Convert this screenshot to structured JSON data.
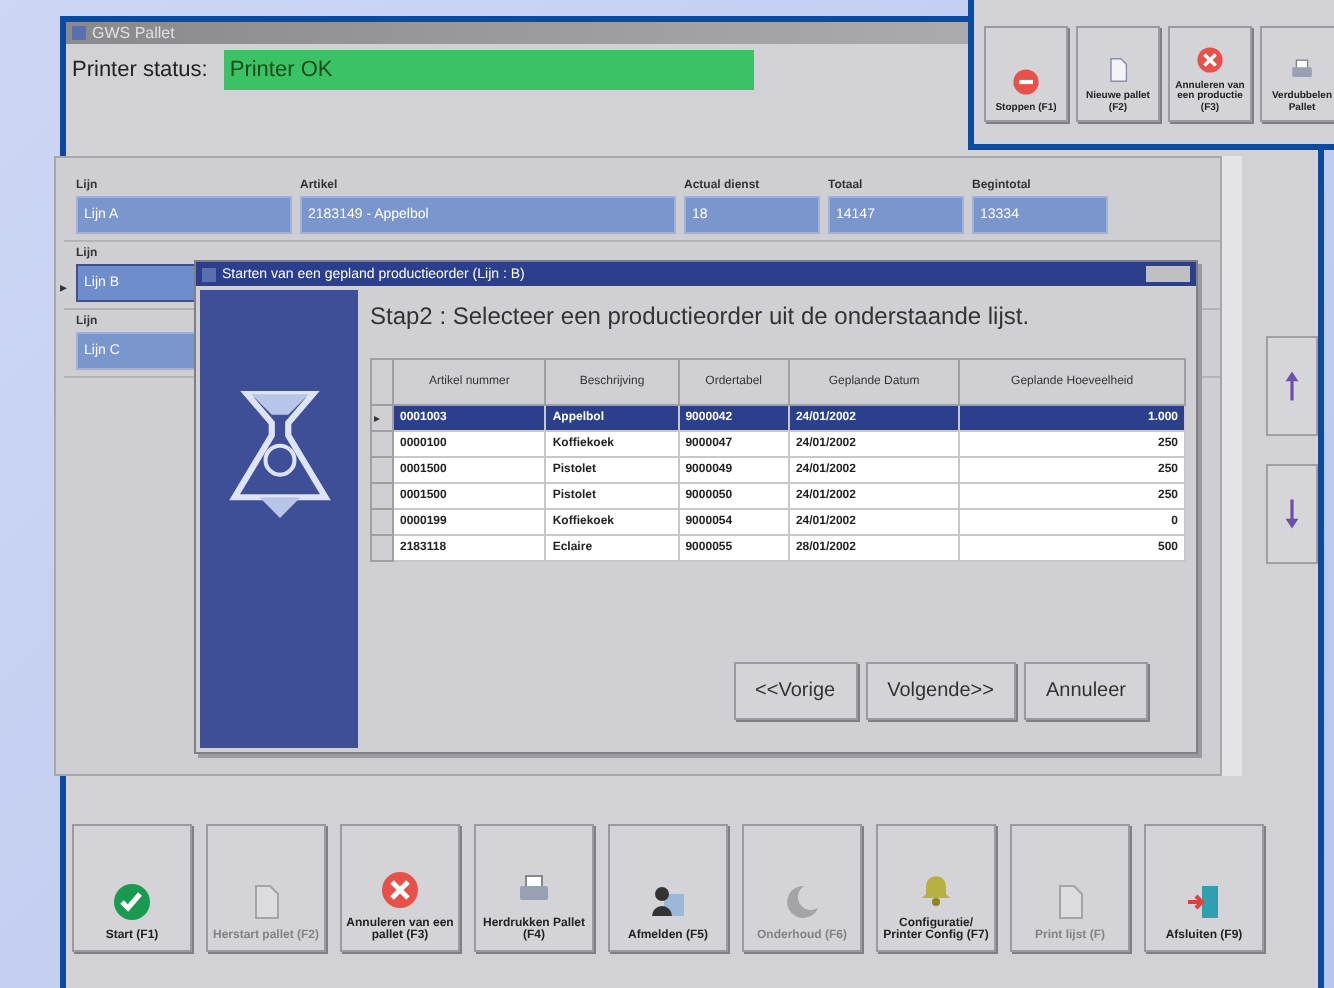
{
  "window": {
    "title": "GWS Pallet"
  },
  "printer_status": {
    "label": "Printer status:",
    "value": "Printer OK",
    "ok": true
  },
  "lines": [
    {
      "selected": false,
      "cells": [
        {
          "header": "Lijn",
          "value": "Lijn A"
        },
        {
          "header": "Artikel",
          "value": "2183149 - Appelbol"
        },
        {
          "header": "Actual dienst",
          "value": "18"
        },
        {
          "header": "Totaal",
          "value": "14147"
        },
        {
          "header": "Begintotal",
          "value": "13334"
        }
      ]
    },
    {
      "selected": true,
      "marker": "▸",
      "cells": [
        {
          "header": "Lijn",
          "value": "Lijn B"
        }
      ]
    },
    {
      "selected": false,
      "cells": [
        {
          "header": "Lijn",
          "value": "Lijn C"
        }
      ]
    }
  ],
  "side_buttons": [
    {
      "kind": "up"
    },
    {
      "kind": "down"
    }
  ],
  "dialog": {
    "title": "Starten van een gepland productieorder (Lijn : B)",
    "heading": "Stap2 : Selecteer een productieorder uit de onderstaande lijst.",
    "columns": [
      "Artikel nummer",
      "Beschrijving",
      "Ordertabel",
      "Geplande Datum",
      "Geplande Hoeveelheid"
    ],
    "rows": [
      {
        "selected": true,
        "marker": "▸",
        "cells": [
          "0001003",
          "Appelbol",
          "9000042",
          "24/01/2002",
          "1.000"
        ]
      },
      {
        "selected": false,
        "cells": [
          "0000100",
          "Koffiekoek",
          "9000047",
          "24/01/2002",
          "250"
        ]
      },
      {
        "selected": false,
        "cells": [
          "0001500",
          "Pistolet",
          "9000049",
          "24/01/2002",
          "250"
        ]
      },
      {
        "selected": false,
        "cells": [
          "0001500",
          "Pistolet",
          "9000050",
          "24/01/2002",
          "250"
        ]
      },
      {
        "selected": false,
        "cells": [
          "0000199",
          "Koffiekoek",
          "9000054",
          "24/01/2002",
          "0"
        ]
      },
      {
        "selected": false,
        "cells": [
          "2183118",
          "Eclaire",
          "9000055",
          "28/01/2002",
          "500"
        ]
      }
    ],
    "buttons": [
      "<<Vorige",
      "Volgende>>",
      "Annuleer"
    ]
  },
  "toolbar": [
    {
      "kind": "check",
      "label": "Start (F1)",
      "disabled": false
    },
    {
      "kind": "page",
      "label": "Herstart pallet (F2)",
      "disabled": true
    },
    {
      "kind": "cancel",
      "label": "Annuleren van een pallet (F3)",
      "disabled": false
    },
    {
      "kind": "printer",
      "label": "Herdrukken Pallet (F4)",
      "disabled": false
    },
    {
      "kind": "person",
      "label": "Afmelden (F5)",
      "disabled": false
    },
    {
      "kind": "moon",
      "label": "Onderhoud (F6)",
      "disabled": true
    },
    {
      "kind": "bell",
      "label": "Configuratie/ Printer Config (F7)",
      "disabled": false
    },
    {
      "kind": "page",
      "label": "Print lijst (F)",
      "disabled": true
    },
    {
      "kind": "exit",
      "label": "Afsluiten (F9)",
      "disabled": false
    }
  ],
  "overlay_toolbar": [
    {
      "kind": "stop",
      "label": "Stoppen (F1)",
      "disabled": false
    },
    {
      "kind": "page",
      "label": "Nieuwe pallet (F2)",
      "disabled": false
    },
    {
      "kind": "cancel",
      "label": "Annuleren van een productie (F3)",
      "disabled": false
    },
    {
      "kind": "printer",
      "label": "Verdubbelen Pallet",
      "disabled": false
    }
  ]
}
